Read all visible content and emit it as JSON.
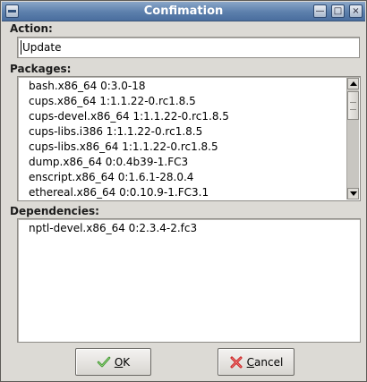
{
  "window": {
    "title": "Confimation"
  },
  "action": {
    "label": "Action:",
    "value": "Update"
  },
  "packages": {
    "label": "Packages:",
    "items": [
      "bash.x86_64 0:3.0-18",
      "cups.x86_64 1:1.1.22-0.rc1.8.5",
      "cups-devel.x86_64 1:1.1.22-0.rc1.8.5",
      "cups-libs.i386 1:1.1.22-0.rc1.8.5",
      "cups-libs.x86_64 1:1.1.22-0.rc1.8.5",
      "dump.x86_64 0:0.4b39-1.FC3",
      "enscript.x86_64 0:1.6.1-28.0.4",
      "ethereal.x86_64 0:0.10.9-1.FC3.1"
    ]
  },
  "dependencies": {
    "label": "Dependencies:",
    "items": [
      "nptl-devel.x86_64 0:2.3.4-2.fc3"
    ]
  },
  "buttons": {
    "ok_mnemonic": "O",
    "ok_rest": "K",
    "cancel_mnemonic": "C",
    "cancel_rest": "ancel"
  },
  "icons": {
    "ok": "check-icon",
    "cancel": "x-icon",
    "window": "window-menu-icon"
  },
  "colors": {
    "titlebar": "#5c7fac",
    "background": "#dcdad5",
    "ok_check": "#3a8f2a",
    "cancel_x": "#c81e1e"
  }
}
